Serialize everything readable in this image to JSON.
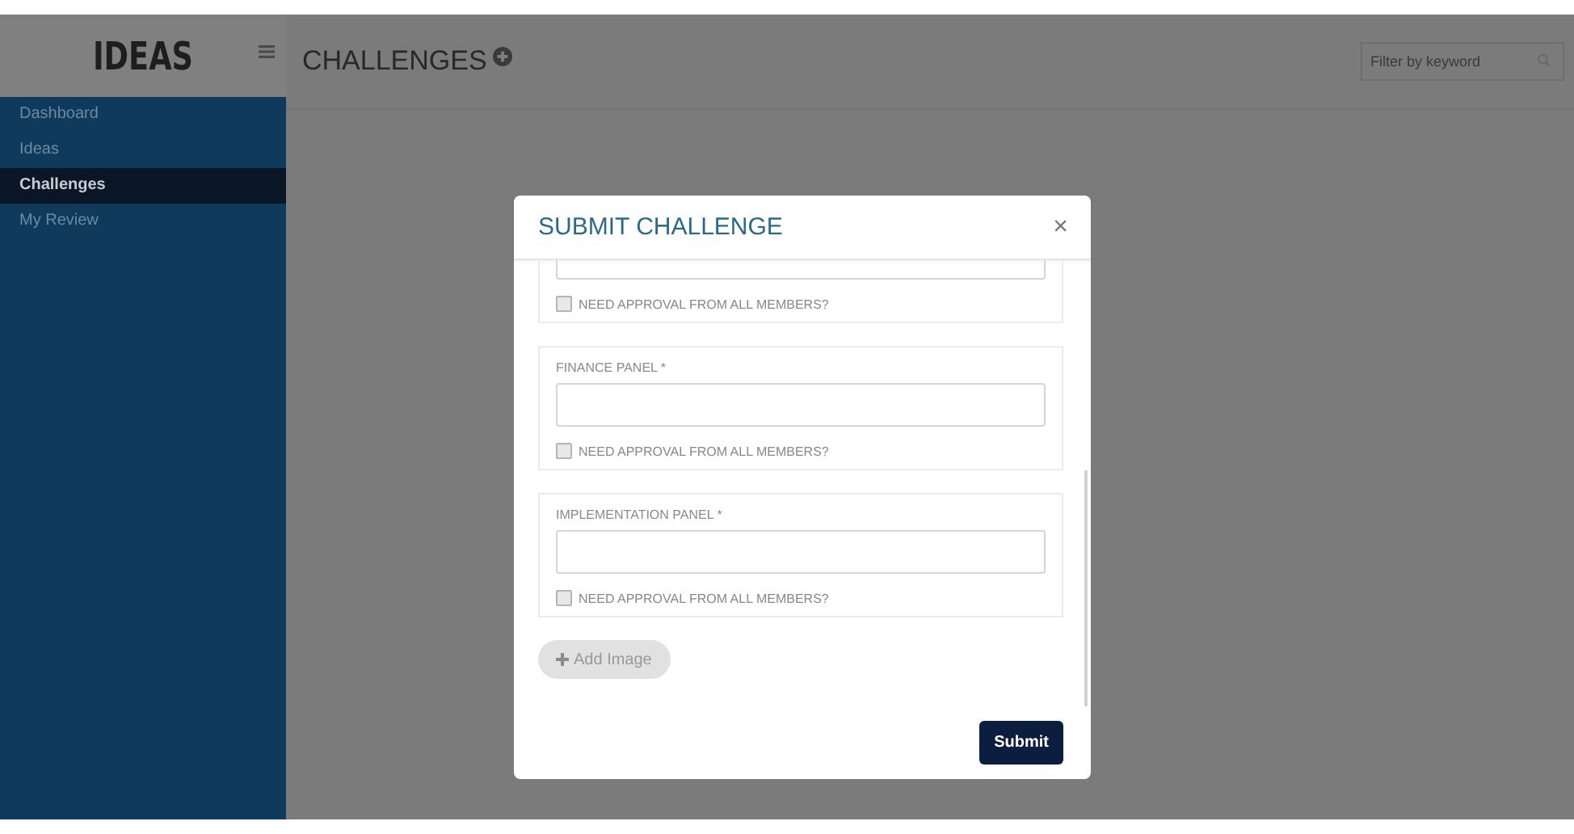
{
  "sidebar": {
    "logo": "IDEAS",
    "items": [
      {
        "label": "Dashboard",
        "selected": false
      },
      {
        "label": "Ideas",
        "selected": false
      },
      {
        "label": "Challenges",
        "selected": true
      },
      {
        "label": "My Review",
        "selected": false
      }
    ]
  },
  "header": {
    "title": "CHALLENGES"
  },
  "search": {
    "placeholder": "Filter by keyword"
  },
  "modal": {
    "title": "SUBMIT CHALLENGE",
    "close": "×",
    "panels": [
      {
        "approval": "NEED APPROVAL FROM ALL MEMBERS?",
        "checked": false
      },
      {
        "label": "FINANCE PANEL *",
        "approval": "NEED APPROVAL FROM ALL MEMBERS?",
        "checked": false
      },
      {
        "label": "IMPLEMENTATION PANEL *",
        "approval": "NEED APPROVAL FROM ALL MEMBERS?",
        "checked": false
      }
    ],
    "add_image": "Add Image",
    "submit": "Submit"
  }
}
